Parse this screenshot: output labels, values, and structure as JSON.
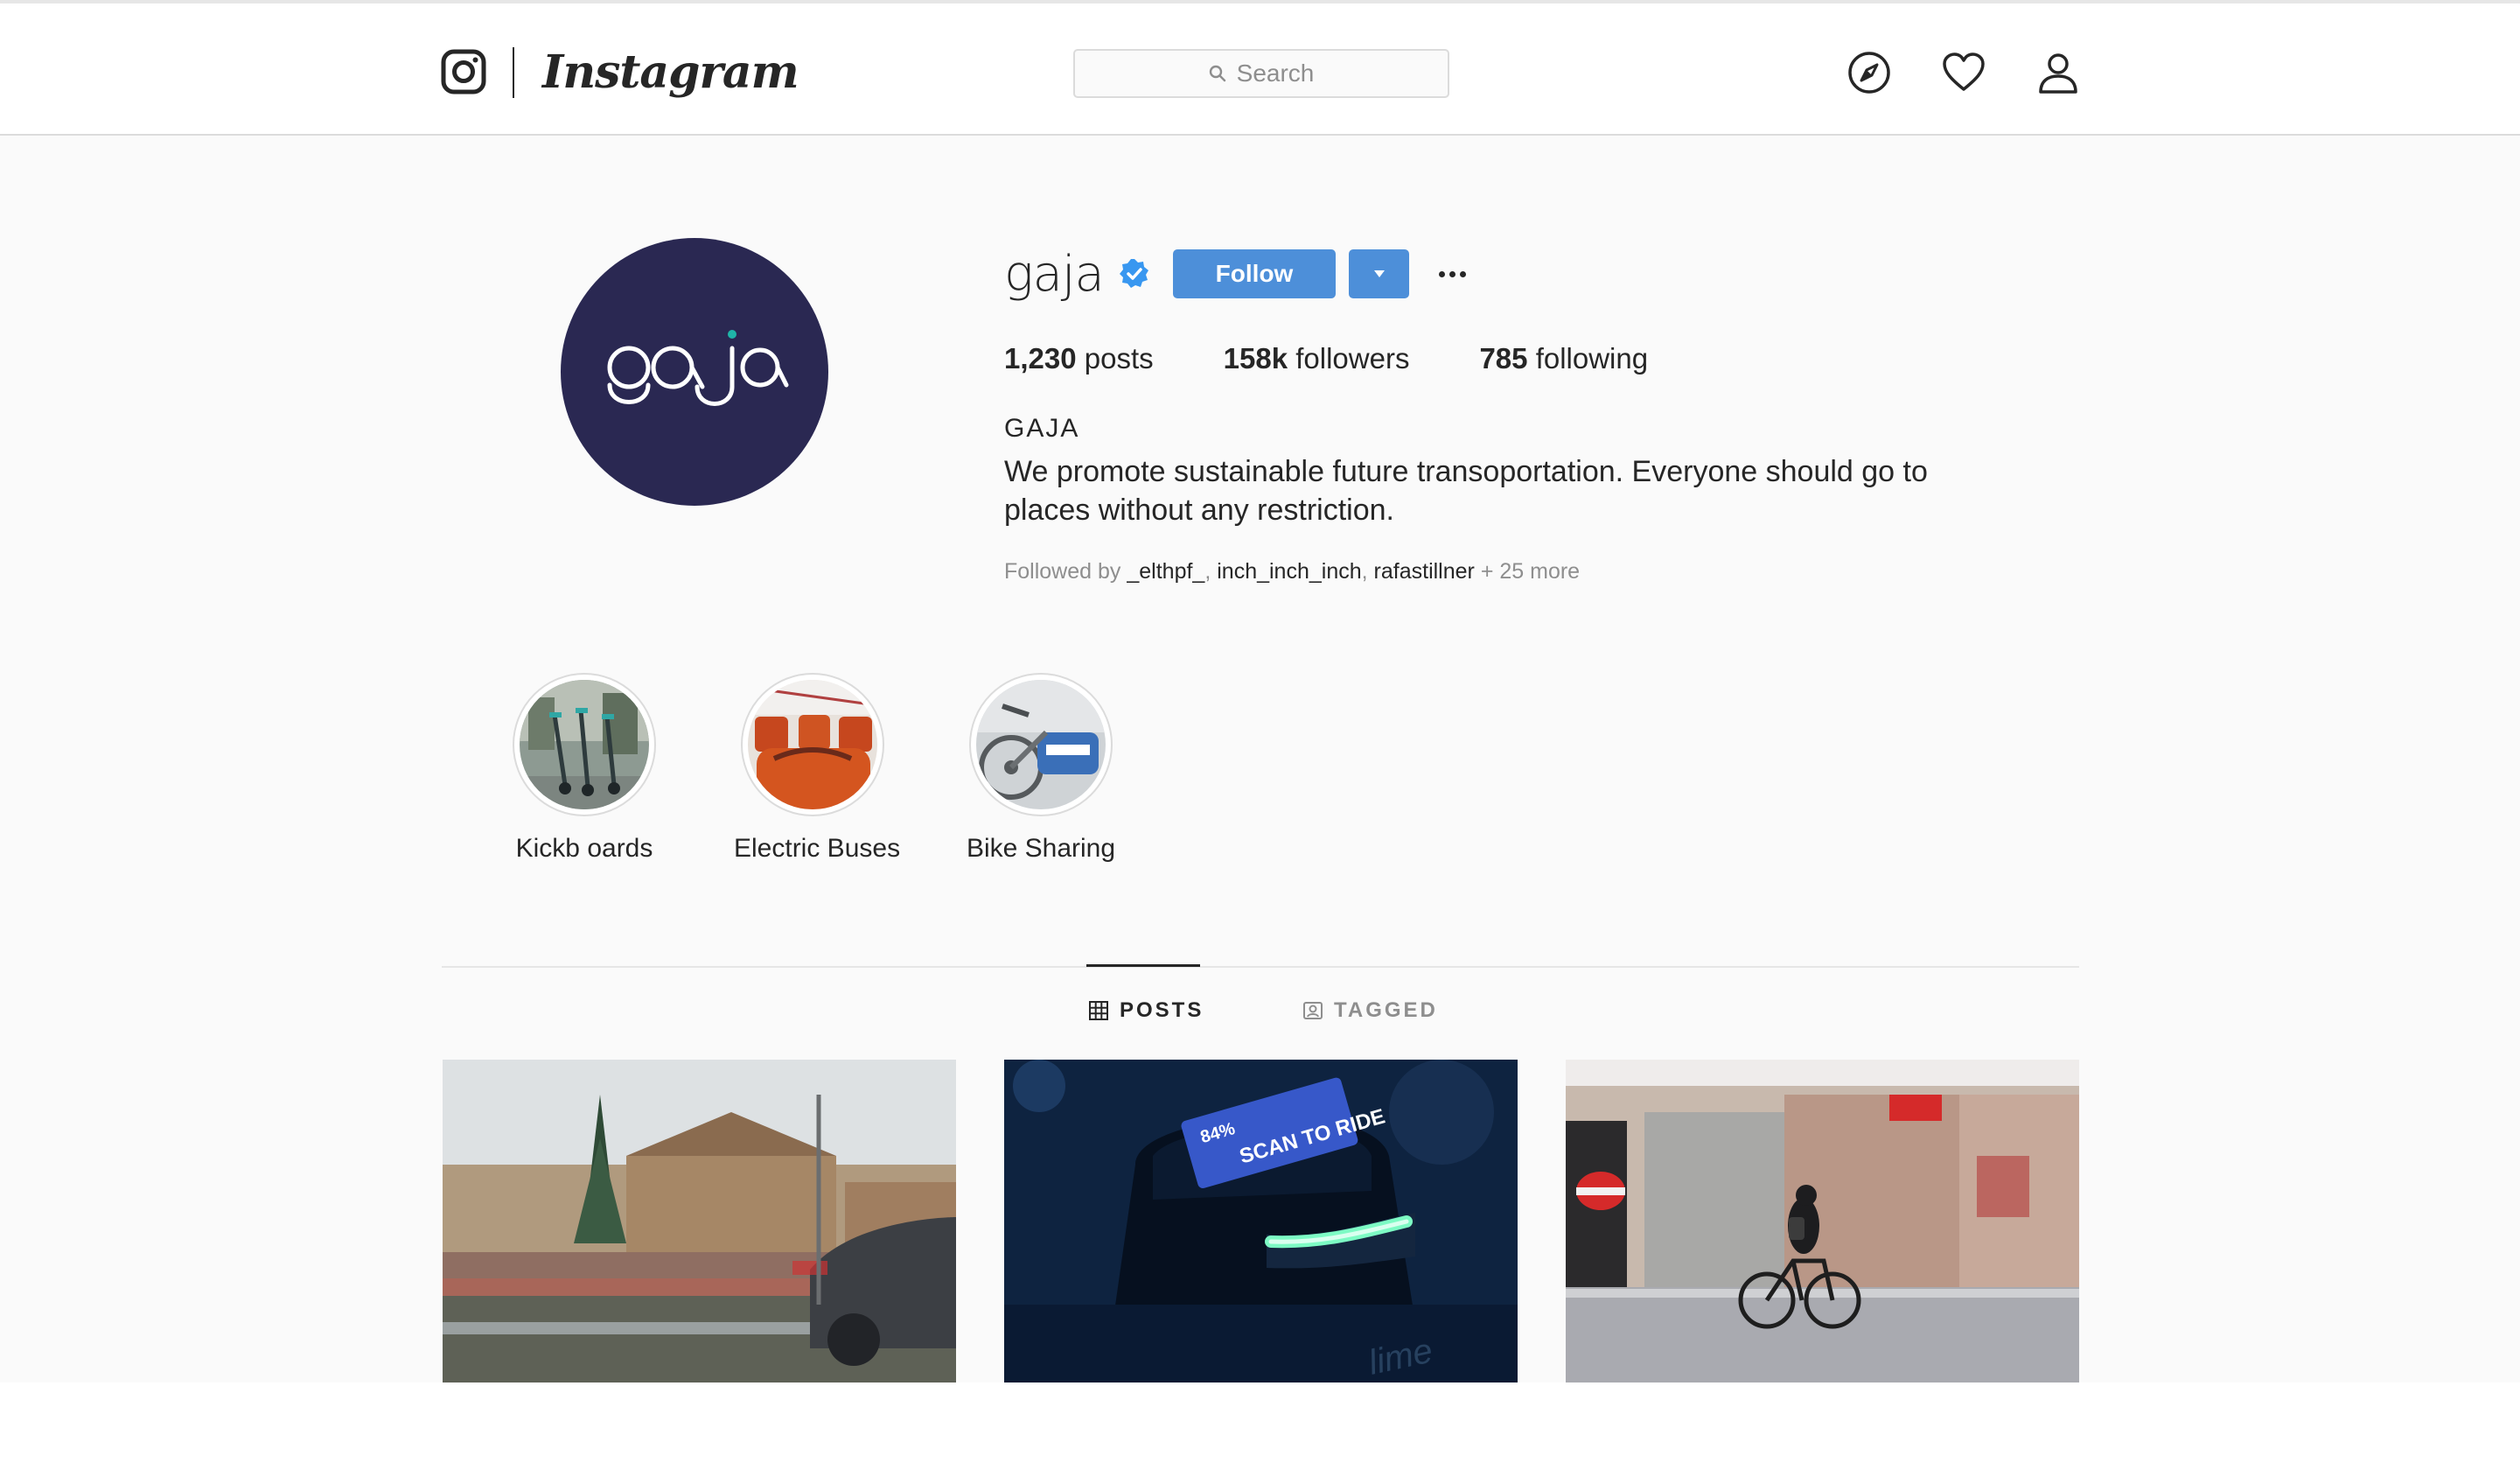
{
  "nav": {
    "logo_glyph": "instagram-camera-icon",
    "wordmark": "Instagram",
    "search_placeholder": "Search",
    "icons": [
      "compass-icon",
      "heart-icon",
      "person-icon"
    ]
  },
  "profile": {
    "username": "gaja",
    "verified": true,
    "follow_label": "Follow",
    "stats": {
      "posts_value": "1,230",
      "posts_label": "posts",
      "followers_value": "158k",
      "followers_label": "followers",
      "following_value": "785",
      "following_label": "following"
    },
    "full_name": "GAJA",
    "bio": "We promote sustainable future transoportation. Everyone should go to places without any restriction.",
    "followed_by": {
      "prefix": "Followed by",
      "names": [
        "_elthpf_",
        "inch_inch_inch",
        "rafastillner"
      ],
      "suffix": "+ 25 more"
    },
    "avatar_text": "ga ja"
  },
  "highlights": [
    {
      "label": "Kickb oards"
    },
    {
      "label": "Electric Buses"
    },
    {
      "label": "Bike Sharing"
    }
  ],
  "tabs": [
    {
      "label": "POSTS",
      "active": true
    },
    {
      "label": "TAGGED",
      "active": false
    }
  ],
  "posts": [
    {
      "subject": "street-with-trees-and-buildings"
    },
    {
      "subject": "scooter-display-scan-to-ride",
      "text": "SCAN TO RIDE",
      "battery": "84%"
    },
    {
      "subject": "cyclist-passing-shops"
    }
  ],
  "colors": {
    "follow_blue": "#4d8fd9",
    "avatar_navy": "#2a2852",
    "avatar_teal": "#1fb5a8",
    "verified_blue": "#3897f0"
  }
}
